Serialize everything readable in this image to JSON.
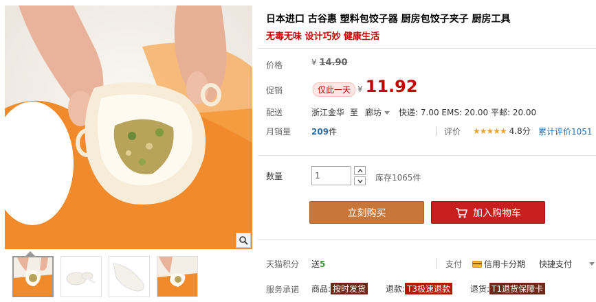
{
  "product": {
    "title": "日本进口 古谷惠 塑料包饺子器 厨房包饺子夹子 厨房工具",
    "subtitle": "无毒无味 设计巧妙 健康生活"
  },
  "price": {
    "label": "价格",
    "currency": "¥",
    "original": "14.90"
  },
  "promo": {
    "label": "促销",
    "badge": "仅此一天",
    "currency": "¥",
    "price": "11.92"
  },
  "shipping": {
    "label": "配送",
    "from": "浙江金华",
    "to_word": "至",
    "to": "廊坊",
    "fees": "快递: 7.00 EMS: 20.00 平邮: 20.00"
  },
  "sales": {
    "label": "月销量",
    "count": "209",
    "unit": "件",
    "rating_label": "评价",
    "stars": "★★★★★",
    "score": "4.8分",
    "total_reviews": "累计评价1051"
  },
  "quantity": {
    "label": "数量",
    "value": "1",
    "stock": "库存1065件"
  },
  "buttons": {
    "buy_now": "立刻购买",
    "add_cart": "加入购物车"
  },
  "points": {
    "label": "天猫积分",
    "give": "送",
    "value": "5",
    "pay_label": "支付",
    "credit": "信用卡分期",
    "quick": "快捷支付"
  },
  "service": {
    "label": "服务承诺",
    "item1_prefix": "商品:",
    "item1_tag": "按时发货",
    "item2_prefix": "退款:",
    "item2_tag": "T3极速退款",
    "item3_prefix": "退货:",
    "item3_tag": "T1退货保障卡"
  },
  "colors": {
    "price_red": "#c40000",
    "buy_button": "#c8773b",
    "cart_button": "#c81e1e",
    "link_blue": "#2d6ea8"
  }
}
